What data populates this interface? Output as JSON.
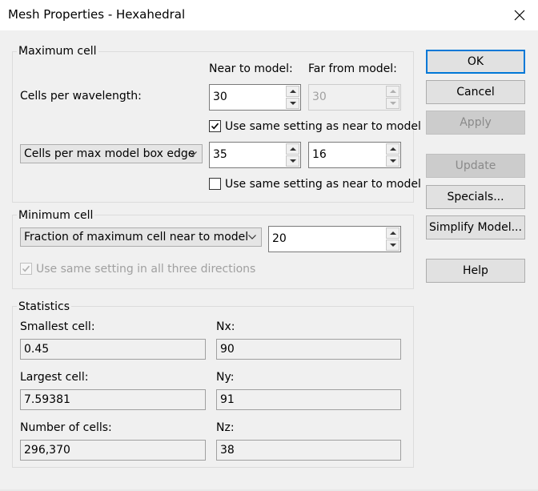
{
  "window": {
    "title": "Mesh Properties - Hexahedral"
  },
  "max_cell": {
    "group_label": "Maximum cell",
    "near_header": "Near to model:",
    "far_header": "Far from model:",
    "cpw_label": "Cells per wavelength:",
    "cpw_near": "30",
    "cpw_far": "30",
    "same_setting_1": "Use same setting as near to model",
    "same_setting_1_checked": true,
    "combo_selected": "Cells per max model box edge",
    "box_near": "35",
    "box_far": "16",
    "same_setting_2": "Use same setting as near to model",
    "same_setting_2_checked": false
  },
  "min_cell": {
    "group_label": "Minimum cell",
    "combo_selected": "Fraction of maximum cell near to model",
    "value": "20",
    "same_dirs": "Use same setting in all three directions",
    "same_dirs_checked": true
  },
  "statistics": {
    "group_label": "Statistics",
    "smallest_label": "Smallest cell:",
    "smallest_value": "0.45",
    "largest_label": "Largest cell:",
    "largest_value": "7.59381",
    "num_label": "Number of cells:",
    "num_value": "296,370",
    "nx_label": "Nx:",
    "nx_value": "90",
    "ny_label": "Ny:",
    "ny_value": "91",
    "nz_label": "Nz:",
    "nz_value": "38"
  },
  "buttons": {
    "ok": "OK",
    "cancel": "Cancel",
    "apply": "Apply",
    "update": "Update",
    "specials": "Specials...",
    "simplify": "Simplify Model...",
    "help": "Help"
  }
}
